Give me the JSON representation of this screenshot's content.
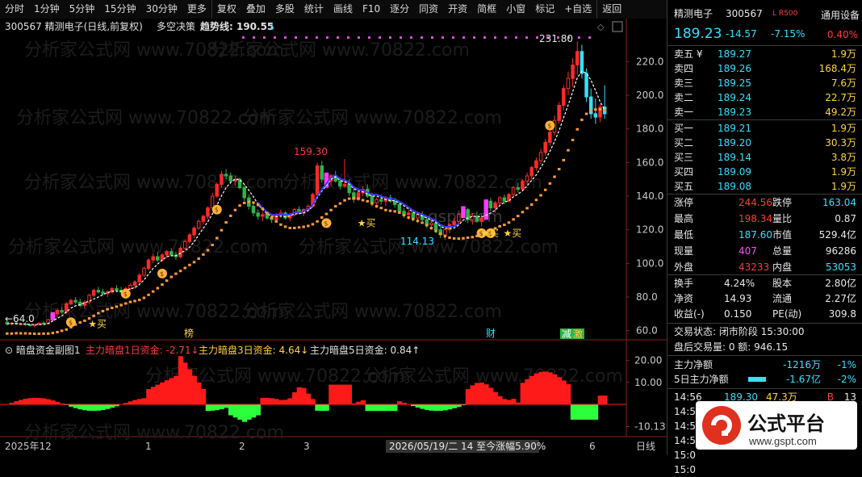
{
  "toolbar": [
    "分时",
    "1分钟",
    "5分钟",
    "15分钟",
    "30分钟",
    "更多",
    "复权",
    "叠加",
    "多股",
    "统计",
    "画线",
    "F10",
    "逐分",
    "同资",
    "开资",
    "简框",
    "小窗",
    "标记",
    "+自选",
    "返回"
  ],
  "header": {
    "code_name": "300567 精测电子(日线,前复权)",
    "indicator": "多空决策",
    "trend_label": "趋势线: 190.55"
  },
  "watermark": "分析家公式网 www.70822.com",
  "watermark2": "gspt.com",
  "main_labels": {
    "high": "231.80",
    "p1": "159.30",
    "low": "114.13",
    "buy": "买",
    "start": "64.0"
  },
  "markers": {
    "bang": "榜",
    "cai": "财",
    "jian": "减",
    "chi": "激"
  },
  "sub": {
    "title": "暗盘资金副图1",
    "l1": "主力暗盘1日资金: -2.71",
    "l3": "主力暗盘3日资金: 4.64",
    "l5": "主力暗盘5日资金: 0.84"
  },
  "bottom": {
    "d0": "2025年12",
    "d1": "1",
    "d2": "2",
    "d3": "3",
    "info": "2026/05/19/二 14 至今涨幅5.90%",
    "d4": "6",
    "period": "日线"
  },
  "panel": {
    "title": "精测电子",
    "code": "300567",
    "tags": "L R500",
    "setting": "通用设备",
    "price": "189.23",
    "chg": "-14.57",
    "pct": "-7.15%",
    "ratio": "0.40%",
    "asks": [
      [
        "卖五 ¥",
        "189.27",
        "1.9万"
      ],
      [
        "卖四",
        "189.26",
        "168.4万"
      ],
      [
        "卖三",
        "189.25",
        "7.6万"
      ],
      [
        "卖二",
        "189.24",
        "22.7万"
      ],
      [
        "卖一",
        "189.23",
        "49.2万"
      ]
    ],
    "bids": [
      [
        "买一",
        "189.21",
        "1.9万"
      ],
      [
        "买二",
        "189.20",
        "30.3万"
      ],
      [
        "买三",
        "189.14",
        "3.8万"
      ],
      [
        "买四",
        "189.09",
        "1.9万"
      ],
      [
        "买五",
        "189.08",
        "1.9万"
      ]
    ],
    "stats": [
      [
        "涨停",
        "244.56",
        "跌停",
        "163.04"
      ],
      [
        "最高",
        "198.34",
        "量比",
        "0.87"
      ],
      [
        "最低",
        "187.60",
        "市值",
        "529.4亿"
      ],
      [
        "现量",
        "407",
        "总量",
        "96286"
      ],
      [
        "外盘",
        "43233",
        "内盘",
        "53053"
      ]
    ],
    "stats2": [
      [
        "换手",
        "4.24%",
        "股本",
        "2.80亿"
      ],
      [
        "净资",
        "14.93",
        "流通",
        "2.27亿"
      ],
      [
        "收益(-)",
        "0.150",
        "PE(动)",
        "309.8"
      ]
    ],
    "status": "交易状态: 闭市阶段 15:30:00",
    "after": "盘后交易量: 0  额: 946.15",
    "main_net": [
      "主力净额",
      "-1216万",
      "-1%"
    ],
    "main_net5": [
      "5日主力净额",
      "-1.67亿",
      "-2%"
    ],
    "ticks": [
      [
        "14:56",
        "189.30",
        "47.3万",
        "B",
        "13"
      ],
      [
        "14:5",
        "",
        "",
        "",
        ""
      ],
      [
        "14:5",
        "",
        "",
        "",
        ""
      ],
      [
        "14:5",
        "",
        "",
        "",
        ""
      ],
      [
        "15:0",
        "",
        "",
        "",
        ""
      ],
      [
        "15:0",
        "",
        "",
        "",
        ""
      ]
    ]
  },
  "logo_text": "公式平台",
  "logo_url": "www.gspt.com",
  "chart_data": {
    "type": "candlestick",
    "y_axis": {
      "ticks": [
        60,
        80,
        100,
        120,
        140,
        160,
        180,
        200,
        220
      ],
      "range": [
        56,
        236
      ]
    },
    "candles": [
      [
        65,
        66,
        63,
        64
      ],
      [
        64,
        65,
        63,
        64.5
      ],
      [
        64.5,
        65,
        63.5,
        64
      ],
      [
        64,
        64.5,
        63,
        64
      ],
      [
        64,
        65,
        63,
        63.5
      ],
      [
        63.5,
        64,
        62.5,
        63
      ],
      [
        63,
        64,
        62,
        63.5
      ],
      [
        63.5,
        65,
        63,
        64.5
      ],
      [
        64.5,
        65.5,
        63.5,
        64
      ],
      [
        64,
        67,
        63.5,
        66.5
      ],
      [
        66.5,
        71,
        66,
        70
      ],
      [
        70,
        73,
        68,
        72
      ],
      [
        72,
        74,
        70,
        71
      ],
      [
        71,
        77,
        70,
        76
      ],
      [
        76,
        79,
        75,
        78
      ],
      [
        78,
        80,
        76,
        77
      ],
      [
        77,
        79,
        74,
        75
      ],
      [
        75,
        78,
        73,
        77
      ],
      [
        77,
        82,
        76,
        81
      ],
      [
        81,
        85,
        80,
        84
      ],
      [
        84,
        86,
        82,
        83
      ],
      [
        83,
        85,
        81,
        82
      ],
      [
        82,
        84,
        80,
        83
      ],
      [
        83,
        86,
        82,
        85
      ],
      [
        85,
        87,
        83,
        84
      ],
      [
        84,
        86,
        82,
        83
      ],
      [
        83,
        86,
        82,
        85
      ],
      [
        85,
        88,
        84,
        87
      ],
      [
        87,
        90,
        85,
        89
      ],
      [
        89,
        94,
        88,
        93
      ],
      [
        93,
        98,
        92,
        97
      ],
      [
        97,
        103,
        96,
        102
      ],
      [
        102,
        106,
        100,
        104
      ],
      [
        104,
        107,
        101,
        102
      ],
      [
        102,
        106,
        101,
        105
      ],
      [
        105,
        108,
        103,
        107
      ],
      [
        107,
        109,
        104,
        105
      ],
      [
        105,
        107,
        102,
        104
      ],
      [
        104,
        110,
        103,
        109
      ],
      [
        109,
        114,
        108,
        113
      ],
      [
        113,
        118,
        112,
        117
      ],
      [
        117,
        122,
        115,
        121
      ],
      [
        121,
        126,
        120,
        125
      ],
      [
        125,
        129,
        123,
        128
      ],
      [
        128,
        134,
        126,
        133
      ],
      [
        133,
        142,
        132,
        140
      ],
      [
        140,
        148,
        139,
        147
      ],
      [
        147,
        155,
        145,
        153
      ],
      [
        153,
        156,
        150,
        152
      ],
      [
        152,
        154,
        147,
        149
      ],
      [
        149,
        152,
        146,
        150
      ],
      [
        150,
        151,
        144,
        145
      ],
      [
        145,
        147,
        137,
        139
      ],
      [
        139,
        141,
        132,
        134
      ],
      [
        134,
        136,
        128,
        130
      ],
      [
        130,
        132,
        126,
        128
      ],
      [
        128,
        131,
        125,
        129
      ],
      [
        129,
        131,
        126,
        127
      ],
      [
        127,
        129,
        124,
        126
      ],
      [
        126,
        130,
        125,
        129
      ],
      [
        129,
        132,
        127,
        130
      ],
      [
        130,
        131,
        126,
        127
      ],
      [
        127,
        130,
        125,
        129
      ],
      [
        129,
        133,
        128,
        132
      ],
      [
        132,
        134,
        129,
        130
      ],
      [
        130,
        133,
        128,
        132
      ],
      [
        132,
        135,
        131,
        134
      ],
      [
        134,
        142,
        133,
        141
      ],
      [
        141,
        160,
        140,
        158
      ],
      [
        158,
        161,
        148,
        150
      ],
      [
        150,
        154,
        145,
        149
      ],
      [
        149,
        153,
        146,
        152
      ],
      [
        152,
        155,
        148,
        149
      ],
      [
        149,
        151,
        144,
        146
      ],
      [
        146,
        162,
        145,
        147
      ],
      [
        147,
        150,
        140,
        142
      ],
      [
        142,
        145,
        136,
        138
      ],
      [
        138,
        143,
        137,
        142
      ],
      [
        142,
        146,
        140,
        144
      ],
      [
        144,
        147,
        139,
        140
      ],
      [
        140,
        142,
        134,
        136
      ],
      [
        136,
        139,
        133,
        138
      ],
      [
        138,
        141,
        135,
        137
      ],
      [
        137,
        140,
        134,
        139
      ],
      [
        139,
        141,
        136,
        137
      ],
      [
        137,
        139,
        133,
        135
      ],
      [
        135,
        137,
        130,
        131
      ],
      [
        131,
        133,
        127,
        129
      ],
      [
        129,
        132,
        126,
        130
      ],
      [
        130,
        132,
        125,
        127
      ],
      [
        127,
        130,
        124,
        129
      ],
      [
        129,
        131,
        125,
        126
      ],
      [
        126,
        128,
        121,
        123
      ],
      [
        123,
        126,
        120,
        124
      ],
      [
        124,
        126,
        118,
        120
      ],
      [
        120,
        123,
        115,
        117
      ],
      [
        117,
        121,
        114,
        120
      ],
      [
        120,
        124,
        118,
        123
      ],
      [
        123,
        127,
        121,
        125
      ],
      [
        125,
        130,
        123,
        129
      ],
      [
        129,
        134,
        127,
        132
      ],
      [
        132,
        133,
        124,
        126
      ],
      [
        126,
        130,
        123,
        128
      ],
      [
        128,
        131,
        124,
        125
      ],
      [
        125,
        129,
        122,
        127
      ],
      [
        127,
        138,
        126,
        137
      ],
      [
        137,
        139,
        131,
        133
      ],
      [
        133,
        137,
        130,
        136
      ],
      [
        136,
        140,
        134,
        139
      ],
      [
        139,
        141,
        135,
        137
      ],
      [
        137,
        142,
        136,
        141
      ],
      [
        141,
        146,
        140,
        145
      ],
      [
        145,
        148,
        142,
        144
      ],
      [
        144,
        150,
        143,
        149
      ],
      [
        149,
        154,
        147,
        152
      ],
      [
        152,
        158,
        150,
        157
      ],
      [
        157,
        163,
        155,
        161
      ],
      [
        161,
        168,
        159,
        166
      ],
      [
        166,
        174,
        164,
        172
      ],
      [
        172,
        180,
        170,
        178
      ],
      [
        178,
        188,
        176,
        185
      ],
      [
        185,
        196,
        183,
        194
      ],
      [
        194,
        206,
        191,
        204
      ],
      [
        204,
        214,
        200,
        210
      ],
      [
        210,
        222,
        205,
        218
      ],
      [
        218,
        232,
        212,
        226
      ],
      [
        226,
        230,
        210,
        213
      ],
      [
        213,
        216,
        196,
        199
      ],
      [
        199,
        204,
        186,
        189
      ],
      [
        189,
        198,
        183,
        187
      ],
      [
        187,
        195,
        184,
        193
      ],
      [
        193,
        206,
        186,
        189
      ]
    ],
    "ma_trend": "line",
    "sub_chart": {
      "type": "area",
      "y_ticks": [
        20,
        10,
        -10.13
      ],
      "range": [
        -14,
        28
      ]
    }
  }
}
